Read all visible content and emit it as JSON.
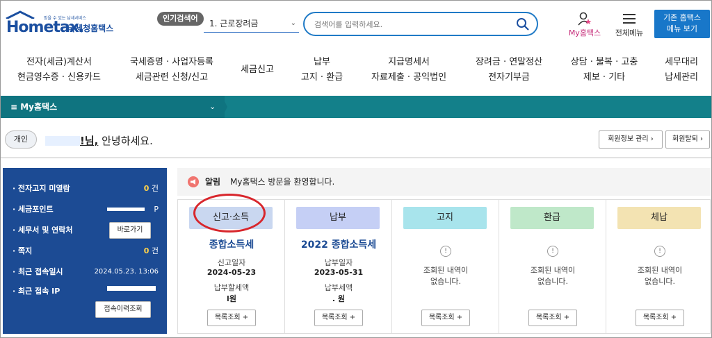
{
  "header": {
    "logo_sub": "믿을 수 있는 납세서비스",
    "logo_main": "Hometax.",
    "logo_kr": "국세청홈택스",
    "popular_badge": "인기검색어",
    "popular_selected": "1.  근로장려금",
    "search_placeholder": "검색어를 입력하세요.",
    "my_hometax": "My홈택스",
    "all_menu": "전체메뉴",
    "old_menu_line1": "기존 홈택스",
    "old_menu_line2": "메뉴 보기"
  },
  "gnb": [
    {
      "l1": "전자(세금)계산서",
      "l2": "현금영수증 · 신용카드"
    },
    {
      "l1": "국세증명 · 사업자등록",
      "l2": "세금관련 신청/신고"
    },
    {
      "l1": "세금신고",
      "l2": ""
    },
    {
      "l1": "납부",
      "l2": "고지 · 환급"
    },
    {
      "l1": "지급명세서",
      "l2": "자료제출 · 공익법인"
    },
    {
      "l1": "장려금 · 연말정산",
      "l2": "전자기부금"
    },
    {
      "l1": "상담 · 불복 · 고충",
      "l2": "제보 · 기타"
    },
    {
      "l1": "세무대리",
      "l2": "납세관리"
    }
  ],
  "subnav": {
    "label": "≡   My홈택스",
    "chev": "⌄"
  },
  "greeting": {
    "type_badge": "개인",
    "name_suffix": "!님,",
    "text": " 안녕하세요.",
    "member_info_btn": "회원정보 관리 ›",
    "withdraw_btn": "회원탈퇴 ›"
  },
  "sidebar": {
    "rows": [
      {
        "k": "· 전자고지 미열람",
        "v": "0",
        "unit": " 건"
      },
      {
        "k": "· 세금포인트",
        "v": "",
        "unit": "P"
      },
      {
        "k": "· 세무서 및 연락처",
        "v": "",
        "unit": ""
      },
      {
        "k": "· 쪽지",
        "v": "0",
        "unit": " 건"
      },
      {
        "k": "· 최근 접속일시",
        "v": "2024.05.23.  13:06",
        "unit": ""
      },
      {
        "k": "· 최근 접속 IP",
        "v": "",
        "unit": ""
      }
    ],
    "shortcut_btn": "바로가기",
    "history_btn": "접속이력조회"
  },
  "notice": {
    "title": "알림",
    "message": "My홈택스 방문을 환영합니다."
  },
  "cards": [
    {
      "tab": "신고·소득",
      "color": "#c9d7f0",
      "main": "종합소득세",
      "l1": "신고일자",
      "v1": "2024-05-23",
      "l2": "납부할세액",
      "v2": "l원",
      "btn": "목록조회 +"
    },
    {
      "tab": "납부",
      "color": "#c5cff5",
      "main": "2022 종합소득세",
      "l1": "납부일자",
      "v1": "2023-05-31",
      "l2": "납부세액",
      "v2": ".    원",
      "btn": "목록조회 +"
    },
    {
      "tab": "고지",
      "color": "#a8e4ec",
      "empty": "조회된 내역이\n없습니다.",
      "btn": "목록조회 +"
    },
    {
      "tab": "환급",
      "color": "#bfe8c9",
      "empty": "조회된 내역이\n없습니다.",
      "btn": "목록조회 +"
    },
    {
      "tab": "체납",
      "color": "#f3e3b2",
      "empty": "조회된 내역이\n없습니다.",
      "btn": "목록조회 +"
    }
  ],
  "colors": {
    "brand": "#1b4fa0",
    "teal": "#13808a",
    "sidebar": "#1c4b94",
    "highlight_circle": "#d8262c"
  }
}
